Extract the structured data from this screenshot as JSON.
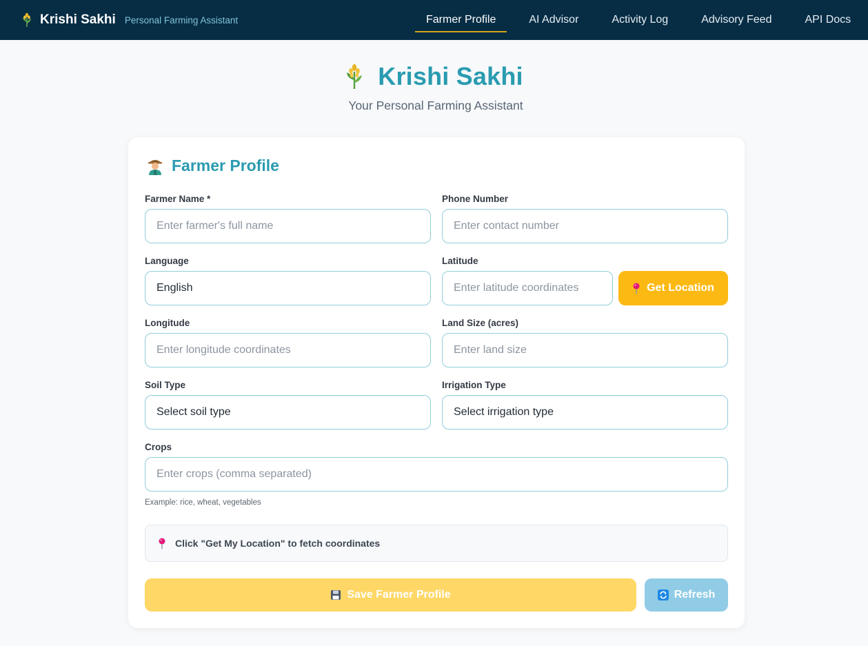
{
  "navbar": {
    "brand_name": "Krishi Sakhi",
    "tagline": "Personal Farming Assistant",
    "brand_icon": "wheat-icon",
    "links": [
      {
        "label": "Farmer Profile",
        "active": true
      },
      {
        "label": "AI Advisor",
        "active": false
      },
      {
        "label": "Activity Log",
        "active": false
      },
      {
        "label": "Advisory Feed",
        "active": false
      },
      {
        "label": "API Docs",
        "active": false
      }
    ]
  },
  "hero": {
    "title": "Krishi Sakhi",
    "subtitle": "Your Personal Farming Assistant",
    "icon": "wheat-icon"
  },
  "form": {
    "title": "Farmer Profile",
    "title_icon": "farmer-icon",
    "farmer_name": {
      "label": "Farmer Name *",
      "value": "",
      "placeholder": "Enter farmer's full name"
    },
    "phone": {
      "label": "Phone Number",
      "value": "",
      "placeholder": "Enter contact number"
    },
    "language": {
      "label": "Language",
      "value": "English"
    },
    "latitude": {
      "label": "Latitude",
      "value": "",
      "placeholder": "Enter latitude coordinates"
    },
    "get_location_label": "Get Location",
    "longitude": {
      "label": "Longitude",
      "value": "",
      "placeholder": "Enter longitude coordinates"
    },
    "land_size": {
      "label": "Land Size (acres)",
      "value": "",
      "placeholder": "Enter land size"
    },
    "soil_type": {
      "label": "Soil Type",
      "value": "Select soil type"
    },
    "irrigation_type": {
      "label": "Irrigation Type",
      "value": "Select irrigation type"
    },
    "crops": {
      "label": "Crops",
      "value": "",
      "placeholder": "Enter crops (comma separated)",
      "hint": "Example: rice, wheat, vegetables"
    },
    "location_status": "Click \"Get My Location\" to fetch coordinates",
    "save_label": "Save Farmer Profile",
    "refresh_label": "Refresh"
  },
  "colors": {
    "navbar_bg": "#072d45",
    "accent_teal": "#2a9bb0",
    "location_button": "#fdb913",
    "save_button": "#fed766",
    "refresh_button": "#90cce6",
    "active_tab_underline": "#d4a418"
  }
}
